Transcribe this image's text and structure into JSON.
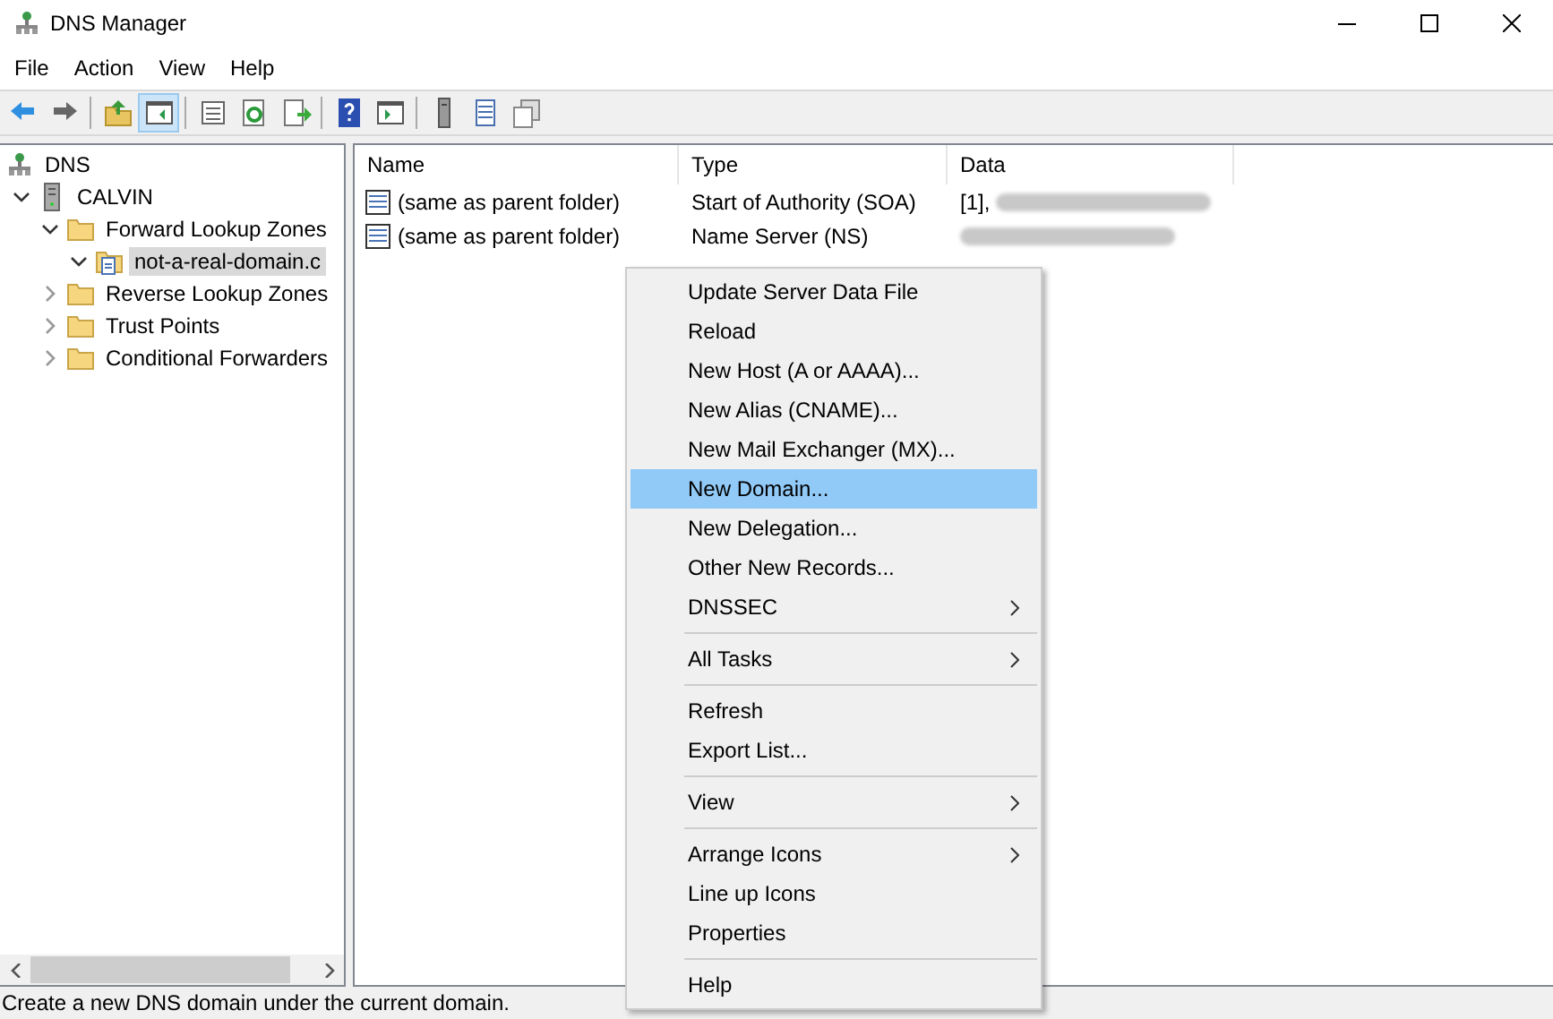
{
  "window": {
    "title": "DNS Manager"
  },
  "menu": [
    "File",
    "Action",
    "View",
    "Help"
  ],
  "toolbar": [
    {
      "pressed": false
    },
    {
      "pressed": false
    },
    {
      "pressed": false
    },
    {
      "pressed": true
    },
    {
      "pressed": false
    },
    {
      "pressed": false
    },
    {
      "pressed": false
    },
    {
      "pressed": false
    },
    {
      "pressed": false
    },
    {
      "pressed": false
    },
    {
      "pressed": false
    },
    {
      "pressed": false
    }
  ],
  "tree": [
    {
      "label": "DNS",
      "kind": "dns",
      "selected": false,
      "children": [
        {
          "label": "CALVIN",
          "kind": "server",
          "expanded": true,
          "selected": false,
          "children": [
            {
              "label": "Forward Lookup Zones",
              "kind": "folder",
              "expanded": true,
              "selected": false,
              "children": [
                {
                  "label": "not-a-real-domain.c",
                  "kind": "zone",
                  "expanded": true,
                  "selected": true
                }
              ]
            },
            {
              "label": "Reverse Lookup Zones",
              "kind": "folder",
              "expanded": false,
              "selected": false
            },
            {
              "label": "Trust Points",
              "kind": "folder",
              "expanded": false,
              "selected": false
            },
            {
              "label": "Conditional Forwarders",
              "kind": "folder",
              "expanded": false,
              "selected": false
            }
          ]
        }
      ]
    }
  ],
  "table": {
    "columns": [
      "Name",
      "Type",
      "Data"
    ],
    "rows": [
      {
        "name": "(same as parent folder)",
        "type": "Start of Authority (SOA)",
        "data": "[1],",
        "redacted": true
      },
      {
        "name": "(same as parent folder)",
        "type": "Name Server (NS)",
        "redacted": true
      }
    ]
  },
  "context_menu": [
    {
      "kind": "item",
      "label": "Update Server Data File",
      "submenu": false,
      "selected": false
    },
    {
      "kind": "item",
      "label": "Reload",
      "submenu": false,
      "selected": false
    },
    {
      "kind": "item",
      "label": "New Host (A or AAAA)...",
      "submenu": false,
      "selected": false
    },
    {
      "kind": "item",
      "label": "New Alias (CNAME)...",
      "submenu": false,
      "selected": false
    },
    {
      "kind": "item",
      "label": "New Mail Exchanger (MX)...",
      "submenu": false,
      "selected": false
    },
    {
      "kind": "item",
      "label": "New Domain...",
      "submenu": false,
      "selected": true
    },
    {
      "kind": "item",
      "label": "New Delegation...",
      "submenu": false,
      "selected": false
    },
    {
      "kind": "item",
      "label": "Other New Records...",
      "submenu": false,
      "selected": false
    },
    {
      "kind": "item",
      "label": "DNSSEC",
      "submenu": true,
      "selected": false
    },
    {
      "kind": "separator"
    },
    {
      "kind": "item",
      "label": "All Tasks",
      "submenu": true,
      "selected": false
    },
    {
      "kind": "separator"
    },
    {
      "kind": "item",
      "label": "Refresh",
      "submenu": false,
      "selected": false
    },
    {
      "kind": "item",
      "label": "Export List...",
      "submenu": false,
      "selected": false
    },
    {
      "kind": "separator"
    },
    {
      "kind": "item",
      "label": "View",
      "submenu": true,
      "selected": false
    },
    {
      "kind": "separator"
    },
    {
      "kind": "item",
      "label": "Arrange Icons",
      "submenu": true,
      "selected": false
    },
    {
      "kind": "item",
      "label": "Line up Icons",
      "submenu": false,
      "selected": false
    },
    {
      "kind": "item",
      "label": "Properties",
      "submenu": false,
      "selected": false
    },
    {
      "kind": "separator"
    },
    {
      "kind": "item",
      "label": "Help",
      "submenu": false,
      "selected": false
    }
  ],
  "status_bar": "Create a new DNS domain under the current domain."
}
